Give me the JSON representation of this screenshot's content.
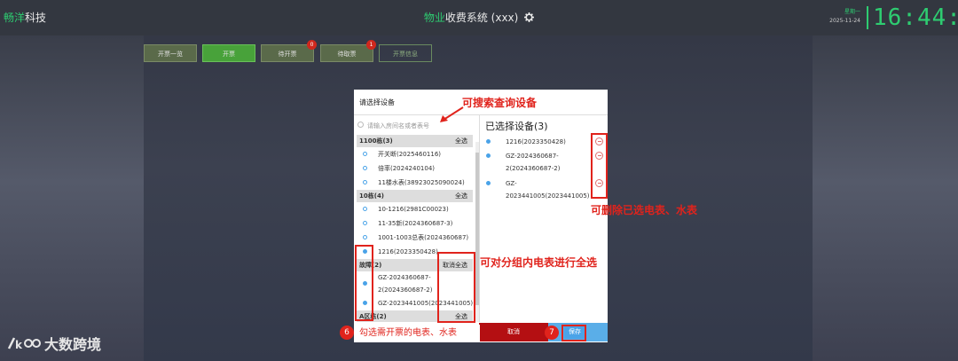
{
  "header": {
    "logo_prefix": "畅洋",
    "logo_suffix": "科技",
    "title_prefix": "物业",
    "title_rest": "收费系统 (xxx)",
    "weekday": "星期一",
    "date": "2025-11-24",
    "time": "16:44:48"
  },
  "tabs": [
    {
      "label": "开票一览",
      "badge": ""
    },
    {
      "label": "开票",
      "badge": ""
    },
    {
      "label": "待开票",
      "badge": "0"
    },
    {
      "label": "待取票",
      "badge": "1"
    },
    {
      "label": "开票信息",
      "badge": ""
    }
  ],
  "dialog": {
    "title": "请选择设备",
    "search_placeholder": "请输入房间名或者表号",
    "groups": [
      {
        "name": "1100栋(3)",
        "action": "全选",
        "items": [
          {
            "label": "开关断(2025460116)",
            "checked": false
          },
          {
            "label": "倍率(2024240104)",
            "checked": false
          },
          {
            "label": "11楼水表(38923025090024)",
            "checked": false
          }
        ]
      },
      {
        "name": "10栋(4)",
        "action": "全选",
        "items": [
          {
            "label": "10-1216(2981C00023)",
            "checked": false
          },
          {
            "label": "11-35新(2024360687-3)",
            "checked": false
          },
          {
            "label": "1001-1003总表(2024360687)",
            "checked": false
          },
          {
            "label": "1216(2023350428)",
            "checked": true
          }
        ]
      },
      {
        "name": "故障(2)",
        "action": "取消全选",
        "items": [
          {
            "label": "GZ-2024360687-",
            "label2": "2(2024360687-2)",
            "checked": true
          },
          {
            "label": "GZ-2023441005(2023441005)",
            "checked": true
          }
        ]
      },
      {
        "name": "A区栋(2)",
        "action": "全选",
        "items": []
      }
    ],
    "selected_title": "已选择设备(3)",
    "selected": [
      {
        "line1": "1216(2023350428)",
        "line2": ""
      },
      {
        "line1": "GZ-2024360687-",
        "line2": "2(2024360687-2)"
      },
      {
        "line1": "GZ-",
        "line2": "2023441005(2023441005)"
      }
    ],
    "cancel_label": "取消",
    "save_label": "保存"
  },
  "annotations": {
    "search_note": "可搜索查询设备",
    "remove_note": "可删除已选电表、水表",
    "group_note": "可对分组内电表进行全选",
    "step6_number": "6",
    "step6_text": "勾选需开票的电表、水表",
    "step7_number": "7"
  },
  "watermark": "大数跨境",
  "colors": {
    "accent_green": "#2ecc71",
    "annotation_red": "#e0231c",
    "cancel_red": "#b40f12",
    "save_blue": "#4aa3e8"
  }
}
